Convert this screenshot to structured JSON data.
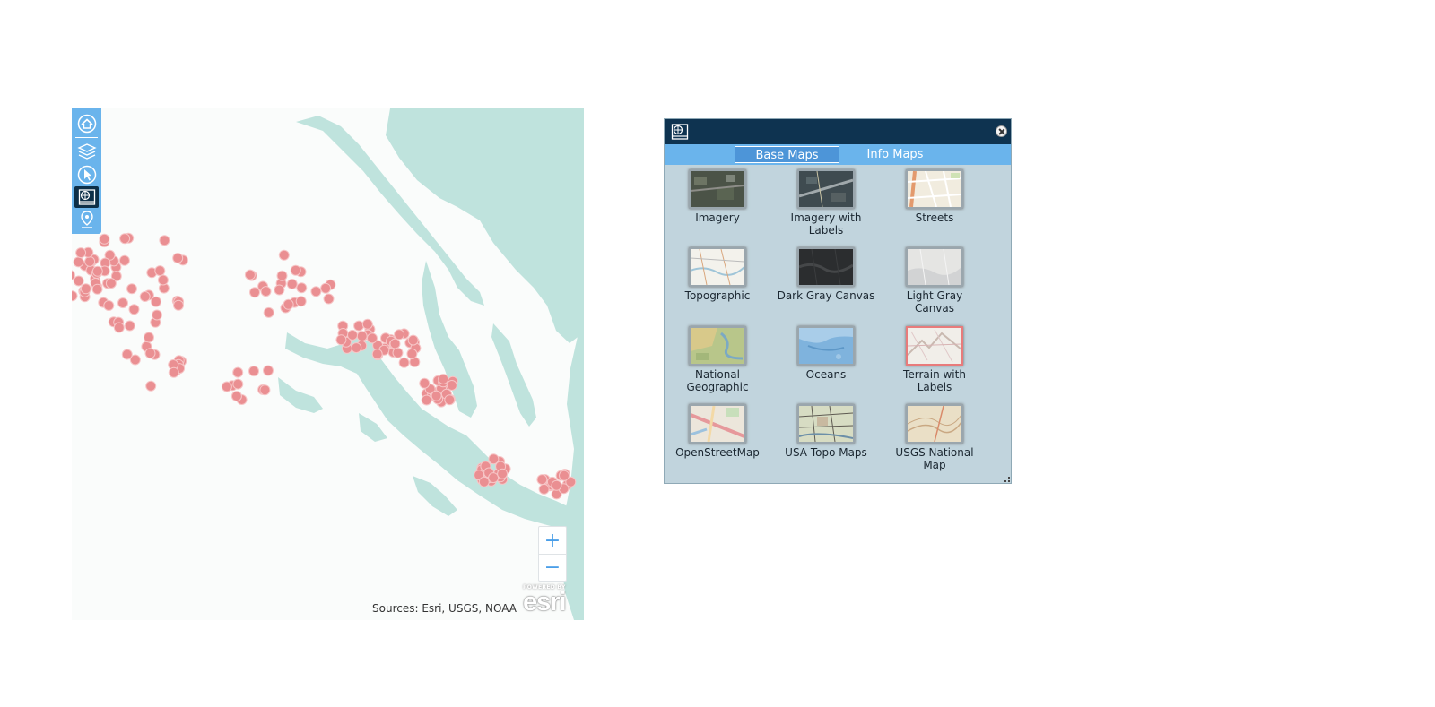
{
  "map": {
    "attribution": "Sources: Esri, USGS, NOAA",
    "logo_text": "esri",
    "logo_tagline": "POWERED BY",
    "zoom_in_label": "+",
    "zoom_out_label": "−",
    "colors": {
      "water": "#bfe3dd",
      "land": "#fafcfb",
      "points": "#ea8f92"
    }
  },
  "toolbar": {
    "icons": [
      "home-icon",
      "layers-icon",
      "select-icon",
      "basemap-gallery-icon",
      "location-icon"
    ],
    "active": "basemap-gallery-icon"
  },
  "basemap_widget": {
    "tabs": [
      {
        "label": "Base Maps",
        "selected": true
      },
      {
        "label": "Info Maps",
        "selected": false
      }
    ],
    "basemaps": [
      {
        "label": "Imagery"
      },
      {
        "label": "Imagery with Labels"
      },
      {
        "label": "Streets"
      },
      {
        "label": "Topographic"
      },
      {
        "label": "Dark Gray Canvas"
      },
      {
        "label": "Light Gray Canvas"
      },
      {
        "label": "National Geographic"
      },
      {
        "label": "Oceans"
      },
      {
        "label": "Terrain with Labels",
        "selected": true
      },
      {
        "label": "OpenStreetMap"
      },
      {
        "label": "USA Topo Maps"
      },
      {
        "label": "USGS National Map"
      }
    ]
  }
}
